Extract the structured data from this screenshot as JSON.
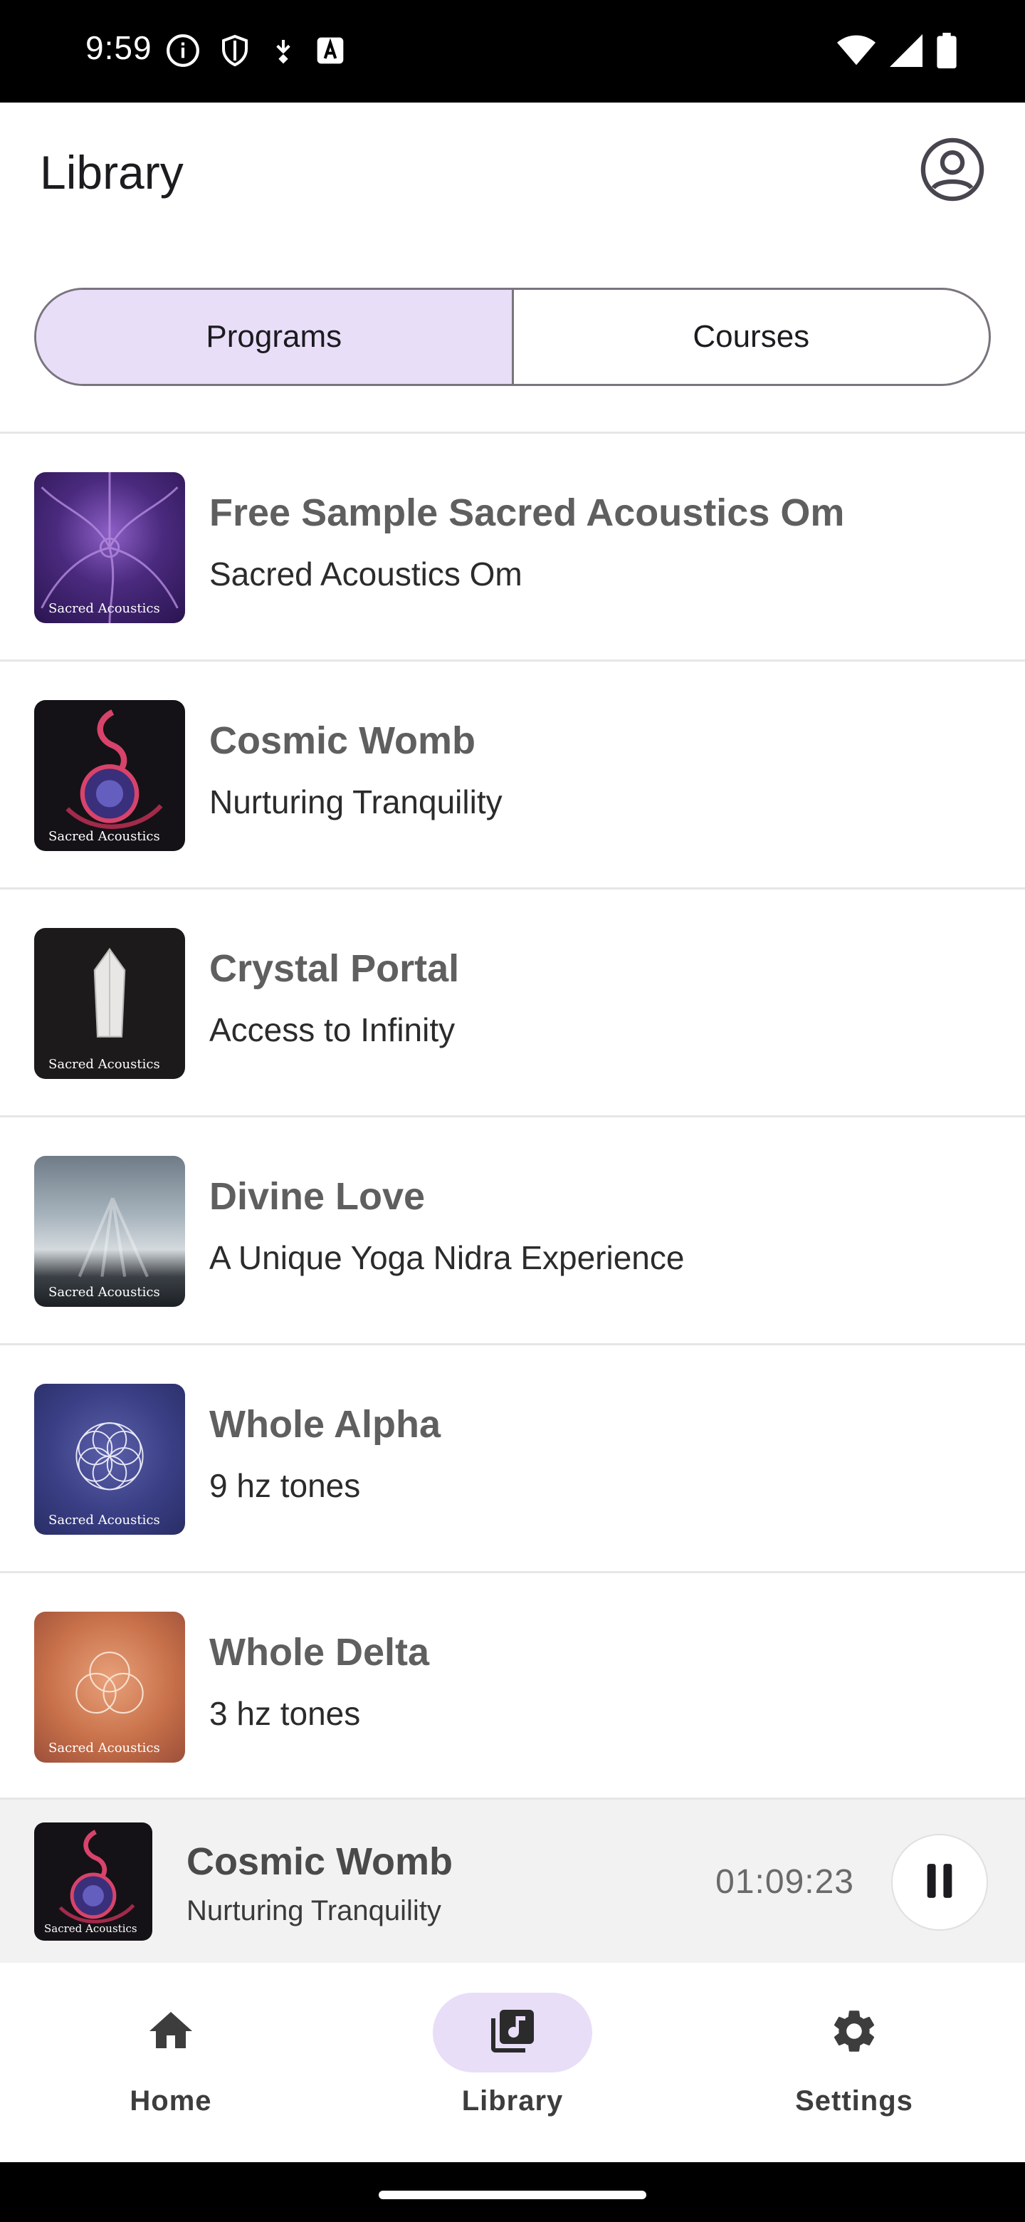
{
  "status_bar": {
    "time": "9:59",
    "left_icons": [
      "info-icon",
      "shield-icon",
      "download-icon",
      "a-icon"
    ],
    "right_icons": [
      "wifi-icon",
      "signal-icon",
      "battery-icon"
    ]
  },
  "header": {
    "title": "Library",
    "account_icon": "account-circle-icon"
  },
  "tabs": {
    "items": [
      "Programs",
      "Courses"
    ],
    "selected": "Programs"
  },
  "programs": [
    {
      "title": "Free Sample Sacred Acoustics Om",
      "subtitle": "Sacred Acoustics Om",
      "brand": "Sacred Acoustics",
      "art": "purple-fractal"
    },
    {
      "title": "Cosmic Womb",
      "subtitle": "Nurturing Tranquility",
      "brand": "Sacred Acoustics",
      "art": "cosmic-spiral"
    },
    {
      "title": "Crystal Portal",
      "subtitle": "Access to Infinity",
      "brand": "Sacred Acoustics",
      "art": "crystal"
    },
    {
      "title": "Divine Love",
      "subtitle": "A Unique Yoga Nidra Experience",
      "brand": "Sacred Acoustics",
      "art": "cloud-rays"
    },
    {
      "title": "Whole Alpha",
      "subtitle": "9 hz tones",
      "brand": "Sacred Acoustics",
      "art": "flower-of-life"
    },
    {
      "title": "Whole Delta",
      "subtitle": "3 hz tones",
      "brand": "Sacred Acoustics",
      "art": "circles"
    }
  ],
  "mini_player": {
    "title": "Cosmic Womb",
    "subtitle": "Nurturing Tranquility",
    "time": "01:09:23",
    "brand": "Sacred Acoustics",
    "state": "playing"
  },
  "bottom_nav": {
    "items": [
      {
        "label": "Home",
        "icon": "home-icon"
      },
      {
        "label": "Library",
        "icon": "library-music-icon"
      },
      {
        "label": "Settings",
        "icon": "gear-icon"
      }
    ],
    "active": "Library"
  },
  "colors": {
    "accent": "#e8def8",
    "outline": "#79747e",
    "mini_player_bg": "#f2f2f2"
  }
}
